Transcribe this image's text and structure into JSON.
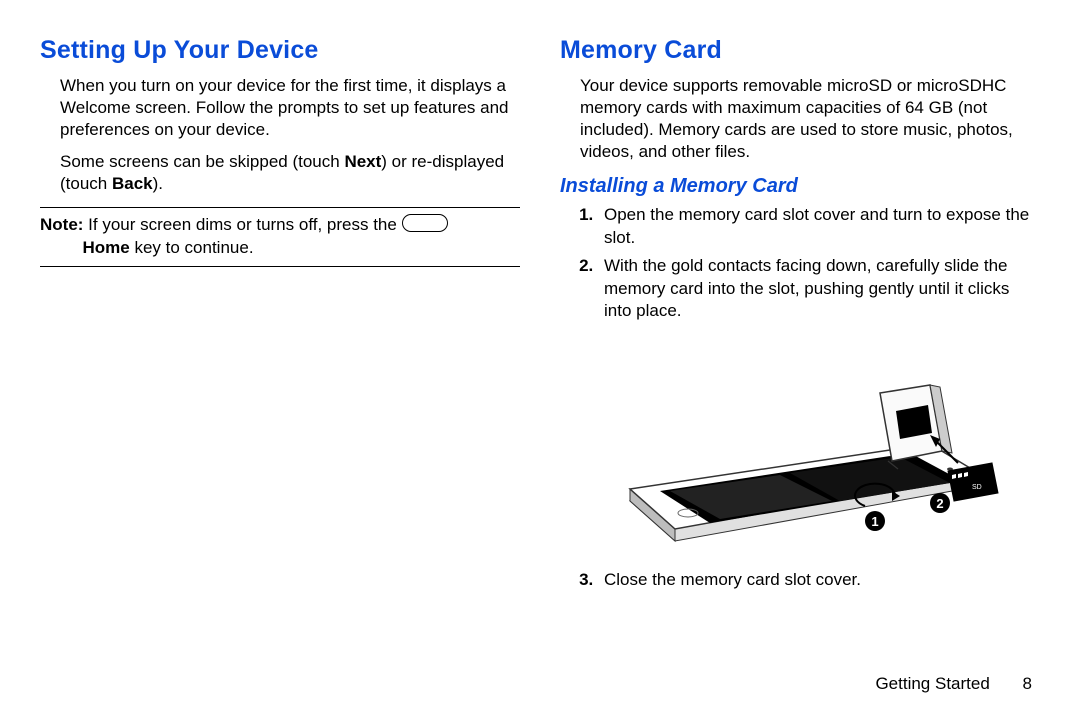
{
  "left": {
    "heading": "Setting Up Your Device",
    "p1": "When you turn on your device for the first time, it displays a Welcome screen. Follow the prompts to set up features and preferences on your device.",
    "p2_a": "Some screens can be skipped (touch ",
    "p2_next": "Next",
    "p2_b": ") or re-displayed (touch ",
    "p2_back": "Back",
    "p2_c": ").",
    "note_label": "Note:",
    "note_a": " If your screen dims or turns off, press the ",
    "note_home": "Home",
    "note_b": " key to continue."
  },
  "right": {
    "heading": "Memory Card",
    "p1": "Your device supports removable microSD or microSDHC memory cards with maximum capacities of 64 GB (not included). Memory cards are used to store music, photos, videos, and other files.",
    "subheading": "Installing a Memory Card",
    "steps": {
      "s1": "Open the memory card slot cover and turn to expose the slot.",
      "s2": "With the gold contacts facing down, carefully slide the memory card into the slot, pushing gently until it clicks into place.",
      "s3": "Close the memory card slot cover."
    },
    "callouts": {
      "c1": "1",
      "c2": "2"
    }
  },
  "footer": {
    "section": "Getting Started",
    "page": "8"
  }
}
